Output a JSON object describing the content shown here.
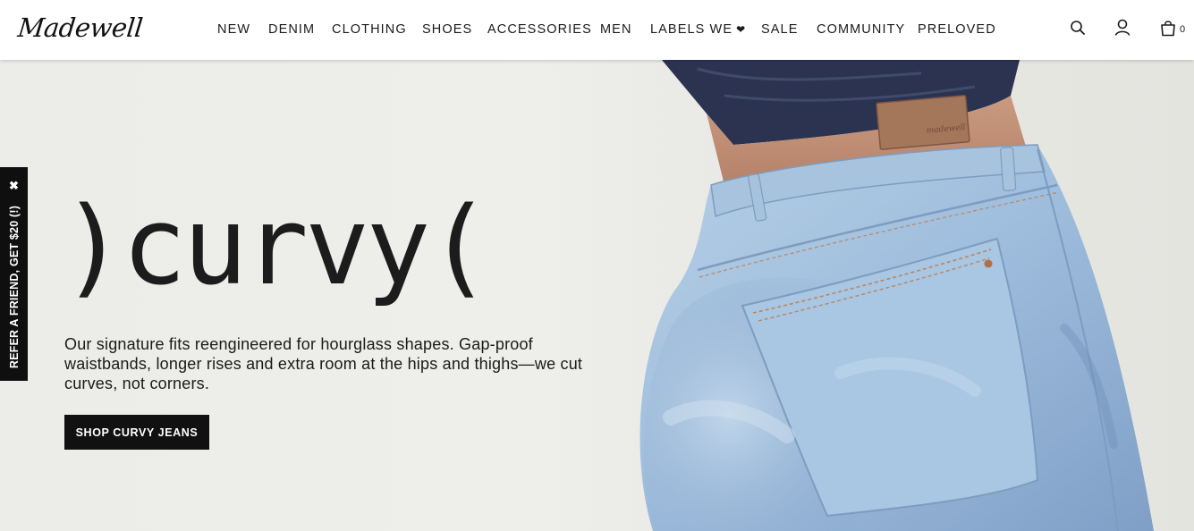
{
  "header": {
    "logo_text": "Madewell",
    "nav": [
      {
        "label": "NEW"
      },
      {
        "label": "DENIM"
      },
      {
        "label": "CLOTHING"
      },
      {
        "label": "SHOES"
      },
      {
        "label": "ACCESSORIES"
      },
      {
        "label": "MEN"
      },
      {
        "label": "LABELS WE",
        "icon": "heart-icon"
      },
      {
        "label": "SALE"
      },
      {
        "label": "COMMUNITY"
      },
      {
        "label": "PRELOVED"
      }
    ],
    "icons": [
      "search-icon",
      "account-icon",
      "shopping-bag-icon"
    ],
    "bag_count": "0"
  },
  "hero": {
    "headline": ")curvy(",
    "body": "Our signature fits reengineered for hourglass shapes. Gap-proof waistbands, longer rises and extra room at the hips and thighs—we cut curves, not corners.",
    "cta_label": "SHOP CURVY JEANS",
    "image_subject": "back view of light-wash curvy jeans with leather waistband patch"
  },
  "refer_tab": {
    "label": "REFER A FRIEND, GET $20 (!)",
    "close_glyph": "✖"
  },
  "colors": {
    "accent_black": "#111111",
    "hero_background": "#ececE8",
    "denim_light": "#a9c6e0",
    "denim_mid": "#8fb3d6",
    "denim_dark": "#6f93bd",
    "leather_patch": "#a4765a",
    "bandana_navy": "#2b3350"
  }
}
